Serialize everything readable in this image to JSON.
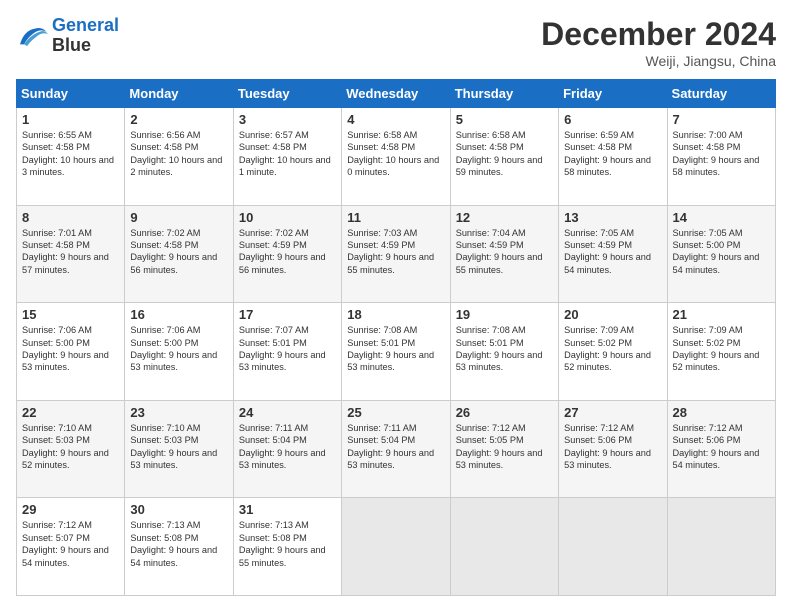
{
  "logo": {
    "line1": "General",
    "line2": "Blue"
  },
  "title": "December 2024",
  "location": "Weiji, Jiangsu, China",
  "days": [
    "Sunday",
    "Monday",
    "Tuesday",
    "Wednesday",
    "Thursday",
    "Friday",
    "Saturday"
  ],
  "weeks": [
    [
      {
        "num": "1",
        "rise": "6:55 AM",
        "set": "4:58 PM",
        "daylight": "10 hours and 3 minutes."
      },
      {
        "num": "2",
        "rise": "6:56 AM",
        "set": "4:58 PM",
        "daylight": "10 hours and 2 minutes."
      },
      {
        "num": "3",
        "rise": "6:57 AM",
        "set": "4:58 PM",
        "daylight": "10 hours and 1 minute."
      },
      {
        "num": "4",
        "rise": "6:58 AM",
        "set": "4:58 PM",
        "daylight": "10 hours and 0 minutes."
      },
      {
        "num": "5",
        "rise": "6:58 AM",
        "set": "4:58 PM",
        "daylight": "9 hours and 59 minutes."
      },
      {
        "num": "6",
        "rise": "6:59 AM",
        "set": "4:58 PM",
        "daylight": "9 hours and 58 minutes."
      },
      {
        "num": "7",
        "rise": "7:00 AM",
        "set": "4:58 PM",
        "daylight": "9 hours and 58 minutes."
      }
    ],
    [
      {
        "num": "8",
        "rise": "7:01 AM",
        "set": "4:58 PM",
        "daylight": "9 hours and 57 minutes."
      },
      {
        "num": "9",
        "rise": "7:02 AM",
        "set": "4:58 PM",
        "daylight": "9 hours and 56 minutes."
      },
      {
        "num": "10",
        "rise": "7:02 AM",
        "set": "4:59 PM",
        "daylight": "9 hours and 56 minutes."
      },
      {
        "num": "11",
        "rise": "7:03 AM",
        "set": "4:59 PM",
        "daylight": "9 hours and 55 minutes."
      },
      {
        "num": "12",
        "rise": "7:04 AM",
        "set": "4:59 PM",
        "daylight": "9 hours and 55 minutes."
      },
      {
        "num": "13",
        "rise": "7:05 AM",
        "set": "4:59 PM",
        "daylight": "9 hours and 54 minutes."
      },
      {
        "num": "14",
        "rise": "7:05 AM",
        "set": "5:00 PM",
        "daylight": "9 hours and 54 minutes."
      }
    ],
    [
      {
        "num": "15",
        "rise": "7:06 AM",
        "set": "5:00 PM",
        "daylight": "9 hours and 53 minutes."
      },
      {
        "num": "16",
        "rise": "7:06 AM",
        "set": "5:00 PM",
        "daylight": "9 hours and 53 minutes."
      },
      {
        "num": "17",
        "rise": "7:07 AM",
        "set": "5:01 PM",
        "daylight": "9 hours and 53 minutes."
      },
      {
        "num": "18",
        "rise": "7:08 AM",
        "set": "5:01 PM",
        "daylight": "9 hours and 53 minutes."
      },
      {
        "num": "19",
        "rise": "7:08 AM",
        "set": "5:01 PM",
        "daylight": "9 hours and 53 minutes."
      },
      {
        "num": "20",
        "rise": "7:09 AM",
        "set": "5:02 PM",
        "daylight": "9 hours and 52 minutes."
      },
      {
        "num": "21",
        "rise": "7:09 AM",
        "set": "5:02 PM",
        "daylight": "9 hours and 52 minutes."
      }
    ],
    [
      {
        "num": "22",
        "rise": "7:10 AM",
        "set": "5:03 PM",
        "daylight": "9 hours and 52 minutes."
      },
      {
        "num": "23",
        "rise": "7:10 AM",
        "set": "5:03 PM",
        "daylight": "9 hours and 53 minutes."
      },
      {
        "num": "24",
        "rise": "7:11 AM",
        "set": "5:04 PM",
        "daylight": "9 hours and 53 minutes."
      },
      {
        "num": "25",
        "rise": "7:11 AM",
        "set": "5:04 PM",
        "daylight": "9 hours and 53 minutes."
      },
      {
        "num": "26",
        "rise": "7:12 AM",
        "set": "5:05 PM",
        "daylight": "9 hours and 53 minutes."
      },
      {
        "num": "27",
        "rise": "7:12 AM",
        "set": "5:06 PM",
        "daylight": "9 hours and 53 minutes."
      },
      {
        "num": "28",
        "rise": "7:12 AM",
        "set": "5:06 PM",
        "daylight": "9 hours and 54 minutes."
      }
    ],
    [
      {
        "num": "29",
        "rise": "7:12 AM",
        "set": "5:07 PM",
        "daylight": "9 hours and 54 minutes."
      },
      {
        "num": "30",
        "rise": "7:13 AM",
        "set": "5:08 PM",
        "daylight": "9 hours and 54 minutes."
      },
      {
        "num": "31",
        "rise": "7:13 AM",
        "set": "5:08 PM",
        "daylight": "9 hours and 55 minutes."
      },
      null,
      null,
      null,
      null
    ]
  ]
}
